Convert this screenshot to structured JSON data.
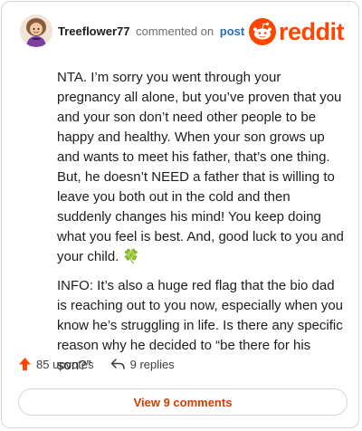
{
  "header": {
    "username": "Treeflower77",
    "action": "commented on",
    "post_link": "post",
    "logo_text": "reddit",
    "avatar_icon": "user-avatar-icon",
    "logo_icon": "reddit-alien-icon"
  },
  "comment": {
    "paragraph1": "NTA. I’m sorry you went through your pregnancy all alone, but you’ve proven that you and your son don’t need other people to be happy and healthy. When your son grows up and wants to meet his father, that’s one thing. But, he doesn’t NEED a father that is willing to leave you both out in the cold and then suddenly changes his mind! You keep doing what you feel is best. And, good luck to you and your child.",
    "paragraph1_emoji": "🍀",
    "paragraph2": "INFO: It’s also a huge red flag that the bio dad is reaching out to you now, especially when you know he’s struggling in life. Is there any specific reason why he decided to “be there for his son?”"
  },
  "footer": {
    "upvotes": "85 upvotes",
    "replies": "9 replies",
    "upvote_icon": "upvote-arrow-icon",
    "reply_icon": "reply-arrow-icon"
  },
  "view_button": {
    "label": "View 9 comments"
  },
  "colors": {
    "brand": "#ff4500",
    "link": "#2b6ab7",
    "button_text": "#d93a00"
  }
}
